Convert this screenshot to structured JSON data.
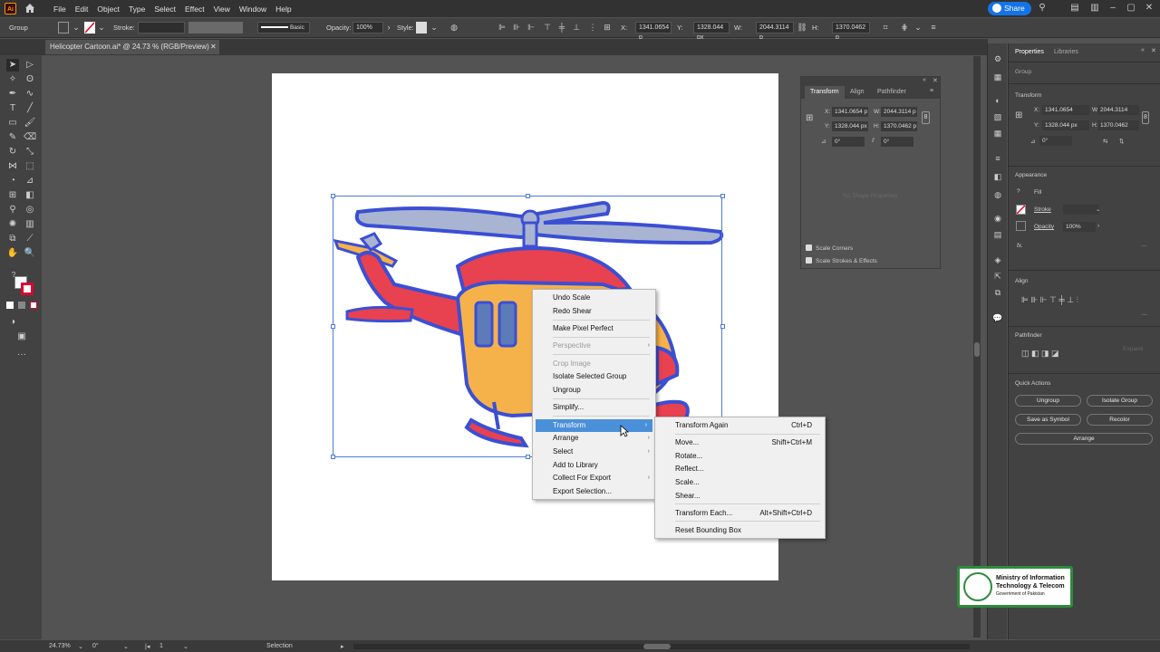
{
  "menubar": {
    "app_badge": "Ai",
    "items": [
      "File",
      "Edit",
      "Object",
      "Type",
      "Select",
      "Effect",
      "View",
      "Window",
      "Help"
    ],
    "share_label": "Share"
  },
  "controlbar": {
    "selection_type": "Group",
    "stroke_label": "Stroke:",
    "brush_label": "Basic",
    "opacity_label": "Opacity:",
    "opacity_value": "100%",
    "style_label": "Style:",
    "x_label": "X:",
    "x_value": "1341.0654 p",
    "y_label": "Y:",
    "y_value": "1328.044 px",
    "w_label": "W:",
    "w_value": "2044.3114 p",
    "h_label": "H:",
    "h_value": "1370.0462 p"
  },
  "document": {
    "tab_title": "Helicopter Cartoon.ai* @ 24.73 % (RGB/Preview)"
  },
  "transform_panel": {
    "tabs": [
      "Transform",
      "Align",
      "Pathfinder"
    ],
    "x_label": "X:",
    "x_value": "1341.0654 p",
    "y_label": "Y:",
    "y_value": "1328.044 px",
    "w_label": "W:",
    "w_value": "2044.3114 p",
    "h_label": "H:",
    "h_value": "1370.0462 p",
    "rotate_value": "0°",
    "shear_value": "0°",
    "empty_text": "No Shape Properties",
    "scale_corners": "Scale Corners",
    "scale_strokes": "Scale Strokes & Effects"
  },
  "properties": {
    "tabs": [
      "Properties",
      "Libraries"
    ],
    "selection": "Group",
    "transform_title": "Transform",
    "x_label": "X:",
    "x_value": "1341.0654",
    "y_label": "Y:",
    "y_value": "1328.044 px",
    "w_label": "W:",
    "w_value": "2044.3114",
    "h_label": "H:",
    "h_value": "1370.0462",
    "rotate_value": "0°",
    "appearance_title": "Appearance",
    "fill_label": "Fill",
    "stroke_label": "Stroke",
    "opacity_label": "Opacity",
    "opacity_value": "100%",
    "fx_label": "fx.",
    "align_title": "Align",
    "pathfinder_title": "Pathfinder",
    "expand_label": "Expand",
    "quick_actions_title": "Quick Actions",
    "ungroup_btn": "Ungroup",
    "isolate_btn": "Isolate Group",
    "save_symbol_btn": "Save as Symbol",
    "recolor_btn": "Recolor",
    "arrange_btn": "Arrange"
  },
  "context_menu": {
    "items": [
      {
        "label": "Undo Scale"
      },
      {
        "label": "Redo Shear"
      },
      {
        "label": "Make Pixel Perfect"
      },
      {
        "label": "Perspective"
      },
      {
        "label": "Crop Image"
      },
      {
        "label": "Isolate Selected Group"
      },
      {
        "label": "Ungroup"
      },
      {
        "label": "Simplify..."
      },
      {
        "label": "Transform"
      },
      {
        "label": "Arrange"
      },
      {
        "label": "Select"
      },
      {
        "label": "Add to Library"
      },
      {
        "label": "Collect For Export"
      },
      {
        "label": "Export Selection..."
      }
    ]
  },
  "transform_submenu": {
    "items": [
      {
        "label": "Transform Again",
        "shortcut": "Ctrl+D"
      },
      {
        "label": "Move...",
        "shortcut": "Shift+Ctrl+M"
      },
      {
        "label": "Rotate...",
        "shortcut": ""
      },
      {
        "label": "Reflect...",
        "shortcut": ""
      },
      {
        "label": "Scale...",
        "shortcut": ""
      },
      {
        "label": "Shear...",
        "shortcut": ""
      },
      {
        "label": "Transform Each...",
        "shortcut": "Alt+Shift+Ctrl+D"
      },
      {
        "label": "Reset Bounding Box",
        "shortcut": ""
      }
    ]
  },
  "statusbar": {
    "zoom": "24.73%",
    "rotation": "0°",
    "artboard_num": "1",
    "tool": "Selection"
  },
  "watermark": {
    "line1": "Ministry of Information",
    "line2": "Technology & Telecom",
    "line3": "Government of Pakistan"
  },
  "colors": {
    "accent": "#1473e6",
    "menu_highlight": "#4a90d9",
    "selection": "#4a7bd6",
    "heli_red": "#e8414f",
    "heli_outline": "#3b4fd4",
    "heli_yellow": "#f6b24a",
    "heli_blade": "#a9b4d2"
  }
}
